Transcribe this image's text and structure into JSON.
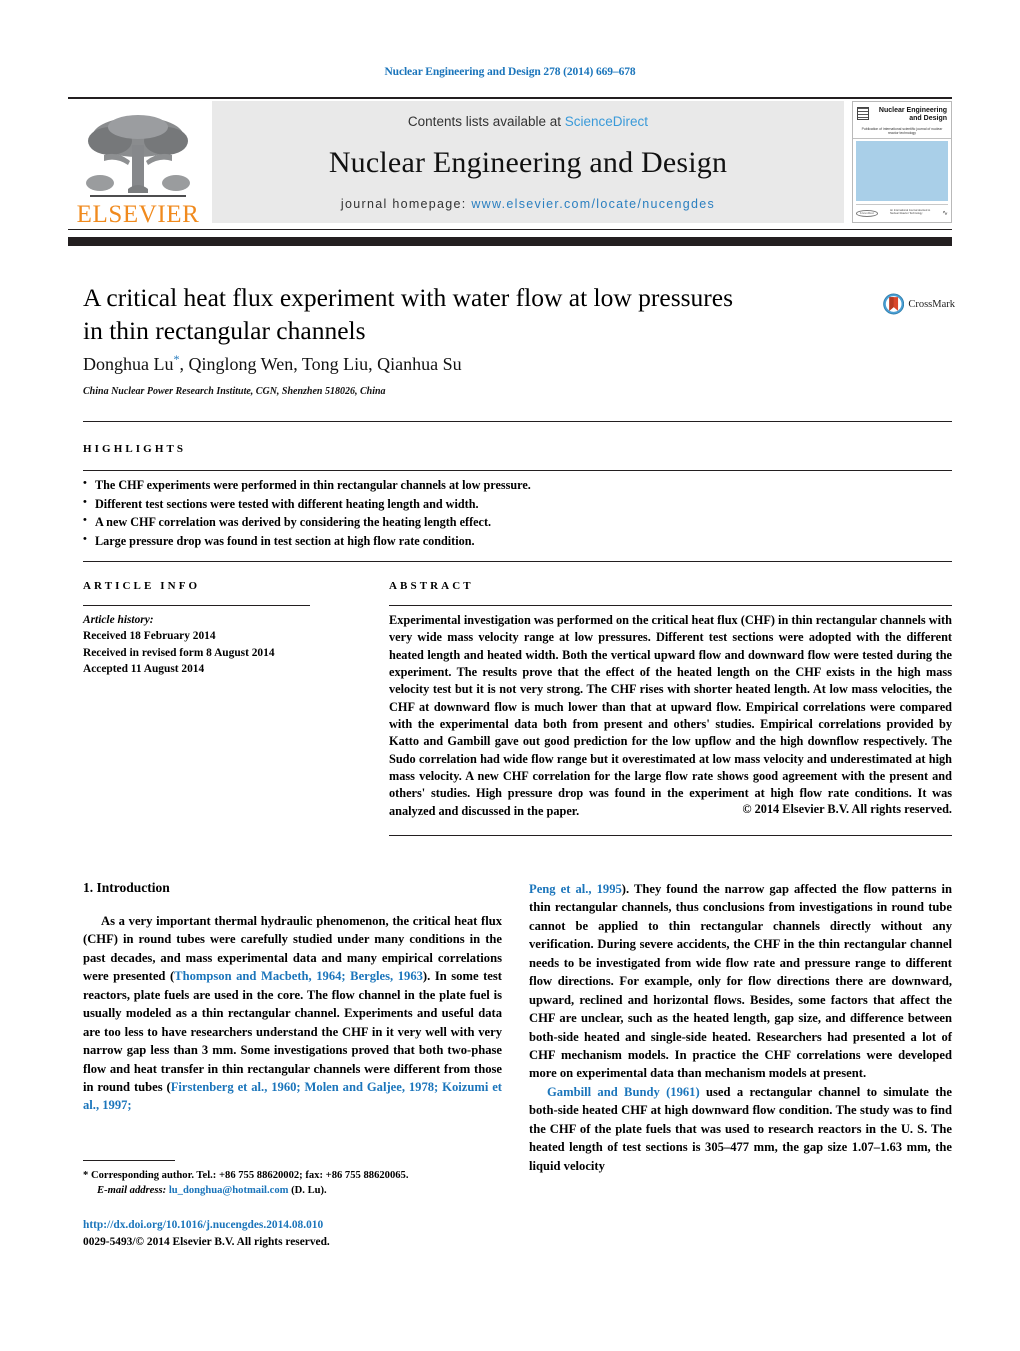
{
  "running_head": "Nuclear Engineering and Design 278 (2014) 669–678",
  "masthead": {
    "publisher_name": "ELSEVIER",
    "contents_prefix": "Contents lists available at",
    "contents_link": "ScienceDirect",
    "journal_title": "Nuclear Engineering and Design",
    "homepage_prefix": "journal homepage:",
    "homepage_url": "www.elsevier.com/locate/nucengdes",
    "cover": {
      "title_line1": "Nuclear Engineering",
      "title_line2": "and Design",
      "subtitle": "Publication of international scientific journal of nuclear reactor technology"
    }
  },
  "article": {
    "title_line1": "A critical heat flux experiment with water flow at low pressures",
    "title_line2": "in thin rectangular channels",
    "crossmark_label": "CrossMark",
    "authors": "Donghua Lu*, Qinglong Wen, Tong Liu, Qianhua Su",
    "authors_plain": "Donghua Lu",
    "authors_rest": ", Qinglong Wen, Tong Liu, Qianhua Su",
    "author_marker": "*",
    "affiliation": "China Nuclear Power Research Institute, CGN, Shenzhen 518026, China"
  },
  "highlights": {
    "heading": "HIGHLIGHTS",
    "items": [
      "The CHF experiments were performed in thin rectangular channels at low pressure.",
      "Different test sections were tested with different heating length and width.",
      "A new CHF correlation was derived by considering the heating length effect.",
      "Large pressure drop was found in test section at high flow rate condition."
    ]
  },
  "article_info": {
    "heading": "ARTICLE INFO",
    "history_label": "Article history:",
    "received": "Received 18 February 2014",
    "revised": "Received in revised form 8 August 2014",
    "accepted": "Accepted 11 August 2014"
  },
  "abstract": {
    "heading": "ABSTRACT",
    "text": "Experimental investigation was performed on the critical heat flux (CHF) in thin rectangular channels with very wide mass velocity range at low pressures. Different test sections were adopted with the different heated length and heated width. Both the vertical upward flow and downward flow were tested during the experiment. The results prove that the effect of the heated length on the CHF exists in the high mass velocity test but it is not very strong. The CHF rises with shorter heated length. At low mass velocities, the CHF at downward flow is much lower than that at upward flow. Empirical correlations were compared with the experimental data both from present and others' studies. Empirical correlations provided by Katto and Gambill gave out good prediction for the low upflow and the high downflow respectively. The Sudo correlation had wide flow range but it overestimated at low mass velocity and underestimated at high mass velocity. A new CHF correlation for the large flow rate shows good agreement with the present and others' studies. High pressure drop was found in the experiment at high flow rate conditions. It was analyzed and discussed in the paper.",
    "copyright": "© 2014 Elsevier B.V. All rights reserved."
  },
  "body": {
    "section_heading": "1. Introduction",
    "left_col": {
      "p1_a": "As a very important thermal hydraulic phenomenon, the critical heat flux (CHF) in round tubes were carefully studied under many conditions in the past decades, and mass experimental data and many empirical correlations were presented (",
      "p1_ref1": "Thompson and Macbeth, 1964; Bergles, 1963",
      "p1_b": "). In some test reactors, plate fuels are used in the core. The flow channel in the plate fuel is usually modeled as a thin rectangular channel. Experiments and useful data are too less to have researchers understand the CHF in it very well with very narrow gap less than 3 mm. Some investigations proved that both two-phase flow and heat transfer in thin rectangular channels were different from those in round tubes (",
      "p1_ref2": "Firstenberg et al., 1960; Molen and Galjee, 1978; Koizumi et al., 1997;"
    },
    "right_col": {
      "p1_ref3": "Peng et al., 1995",
      "p1_c": "). They found the narrow gap affected the flow patterns in thin rectangular channels, thus conclusions from investigations in round tube cannot be applied to thin rectangular channels directly without any verification. During severe accidents, the CHF in the thin rectangular channel needs to be investigated from wide flow rate and pressure range to different flow directions. For example, only for flow directions there are downward, upward, reclined and horizontal flows. Besides, some factors that affect the CHF are unclear, such as the heated length, gap size, and difference between both-side heated and single-side heated. Researchers had presented a lot of CHF mechanism models. In practice the CHF correlations were developed more on experimental data than mechanism models at present.",
      "p2_ref": "Gambill and Bundy (1961)",
      "p2_text": " used a rectangular channel to simulate the both-side heated CHF at high downward flow condition. The study was to find the CHF of the plate fuels that was used to research reactors in the U. S. The heated length of test sections is 305–477 mm, the gap size 1.07–1.63 mm, the liquid velocity"
    }
  },
  "footnotes": {
    "corresponding": "* Corresponding author. Tel.: +86 755 88620002; fax: +86 755 88620065.",
    "email_label": "E-mail address:",
    "email": "lu_donghua@hotmail.com",
    "email_suffix": " (D. Lu).",
    "doi": "http://dx.doi.org/10.1016/j.nucengdes.2014.08.010",
    "issn_line": "0029-5493/© 2014 Elsevier B.V. All rights reserved."
  },
  "colors": {
    "link": "#1b75bb",
    "elsevier_orange": "#f08a1e",
    "band_gray": "#e9e9e9",
    "rule_dark": "#231f20"
  }
}
